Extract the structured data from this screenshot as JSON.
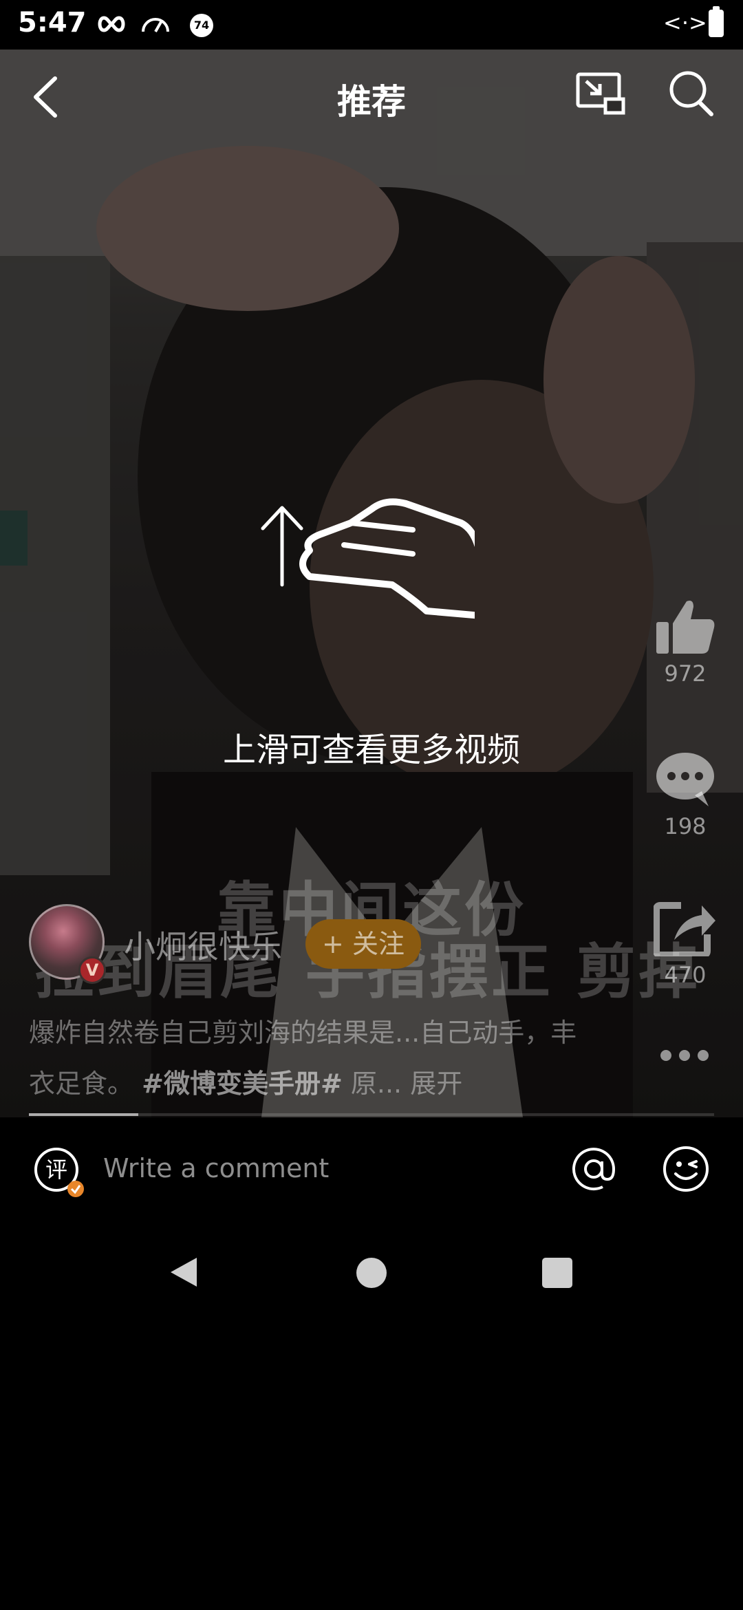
{
  "status_bar": {
    "time": "5:47",
    "battery_badge": "74",
    "network": "<·>"
  },
  "header": {
    "title": "推荐"
  },
  "overlay_hint": {
    "text": "上滑可查看更多视频"
  },
  "video_caption": {
    "line1": "靠中间这份",
    "line2": "拉到眉尾 手指摆正 剪掉"
  },
  "side_actions": {
    "likes": "972",
    "comments": "198",
    "shares": "470"
  },
  "author": {
    "name": "小炯很快乐",
    "verified_badge": "V",
    "follow_label": "+ 关注"
  },
  "description": {
    "text": "爆炸自然卷自己剪刘海的结果是...自己动手，丰衣足食。",
    "hashtag": "#微博变美手册#",
    "tail": "原...",
    "expand": "展开"
  },
  "playback": {
    "progress": 0.16
  },
  "comment_bar": {
    "icon_char": "评",
    "placeholder": "Write a comment"
  },
  "colors": {
    "follow_bg": "#8a5a10",
    "badge_red": "#a8262a",
    "badge_orange": "#e8862a"
  }
}
